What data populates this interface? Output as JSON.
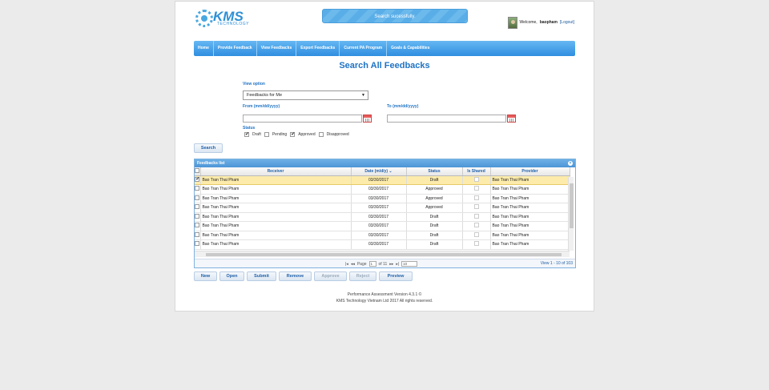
{
  "brand": {
    "name": "KMS",
    "tagline": "TECHNOLOGY",
    "color": "#2d8fd5"
  },
  "toast": {
    "message": "Search sucessfully."
  },
  "user": {
    "welcome": "Welcome,",
    "name": "baopham",
    "logout": "[Logout]"
  },
  "nav": [
    "Home",
    "Provide Feedback",
    "View Feedbacks",
    "Export Feedbacks",
    "Current PA Program",
    "Goals & Capabilities"
  ],
  "page_title": "Search All Feedbacks",
  "form": {
    "view_option_label": "View option",
    "view_option_value": "Feedbacks for Me",
    "from_label": "From (mm/dd/yyyy)",
    "to_label": "To (mm/dd/yyyy)",
    "status_label": "Status",
    "statuses": [
      {
        "label": "Draft",
        "checked": true
      },
      {
        "label": "Pending",
        "checked": false
      },
      {
        "label": "Approved",
        "checked": true
      },
      {
        "label": "Disapproved",
        "checked": false
      }
    ],
    "search_button": "Search"
  },
  "grid": {
    "caption": "Feedbacks list",
    "columns": [
      "Receiver",
      "Date (m/d/y)",
      "Status",
      "Is Shared",
      "Provider"
    ],
    "sort_indicator": "⌄",
    "rows": [
      {
        "receiver": "Bao Tran Thai Pham",
        "date": "03/30/2017",
        "status": "Draft",
        "shared": false,
        "provider": "Bao Tran Thai Pham",
        "selected": true
      },
      {
        "receiver": "Bao Tran Thai Pham",
        "date": "03/30/2017",
        "status": "Approved",
        "shared": false,
        "provider": "Bao Tran Thai Pham",
        "selected": false
      },
      {
        "receiver": "Bao Tran Thai Pham",
        "date": "03/30/2017",
        "status": "Approved",
        "shared": false,
        "provider": "Bao Tran Thai Pham",
        "selected": false
      },
      {
        "receiver": "Bao Tran Thai Pham",
        "date": "03/30/2017",
        "status": "Approved",
        "shared": false,
        "provider": "Bao Tran Thai Pham",
        "selected": false
      },
      {
        "receiver": "Bao Tran Thai Pham",
        "date": "03/30/2017",
        "status": "Draft",
        "shared": false,
        "provider": "Bao Tran Thai Pham",
        "selected": false
      },
      {
        "receiver": "Bao Tran Thai Pham",
        "date": "03/30/2017",
        "status": "Draft",
        "shared": false,
        "provider": "Bao Tran Thai Pham",
        "selected": false
      },
      {
        "receiver": "Bao Tran Thai Pham",
        "date": "03/30/2017",
        "status": "Draft",
        "shared": false,
        "provider": "Bao Tran Thai Pham",
        "selected": false
      },
      {
        "receiver": "Bao Tran Thai Pham",
        "date": "03/30/2017",
        "status": "Draft",
        "shared": false,
        "provider": "Bao Tran Thai Pham",
        "selected": false
      }
    ],
    "pager": {
      "page_label": "Page",
      "page": "1",
      "of_label": "of 11",
      "page_size": "10",
      "view_info": "View 1 - 10 of 103"
    }
  },
  "actions": [
    {
      "label": "New",
      "enabled": true
    },
    {
      "label": "Open",
      "enabled": true
    },
    {
      "label": "Submit",
      "enabled": true
    },
    {
      "label": "Remove",
      "enabled": true
    },
    {
      "label": "Approve",
      "enabled": false
    },
    {
      "label": "Reject",
      "enabled": false
    },
    {
      "label": "Preview",
      "enabled": true
    }
  ],
  "footer": {
    "line1": "Performance Assessment Version 4.3.1 ©",
    "line2": "KMS Technology Vietnam Ltd 2017 All rights reserved."
  }
}
